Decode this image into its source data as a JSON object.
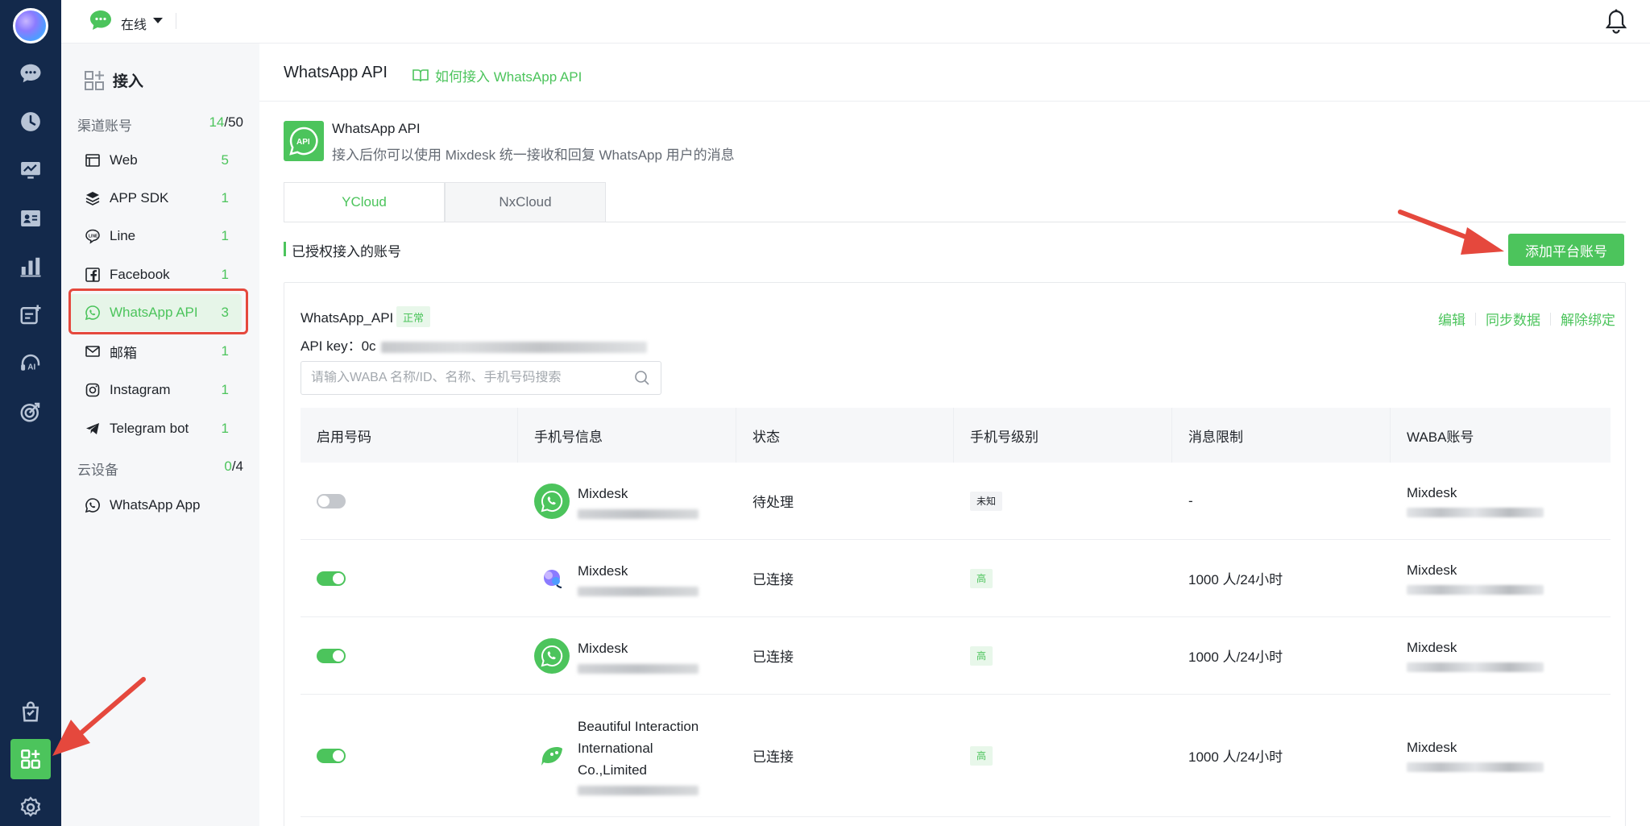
{
  "topbar": {
    "status_label": "在线"
  },
  "rail": {
    "items": [
      {
        "icon": "chat-icon"
      },
      {
        "icon": "history-icon"
      },
      {
        "icon": "monitor-icon"
      },
      {
        "icon": "contacts-icon"
      },
      {
        "icon": "stats-icon"
      },
      {
        "icon": "ticket-icon"
      },
      {
        "icon": "ai-agent-icon"
      },
      {
        "icon": "target-icon"
      },
      {
        "icon": "shopping-bag-icon"
      },
      {
        "icon": "integration-icon"
      },
      {
        "icon": "settings-icon"
      }
    ],
    "active": "integration-icon"
  },
  "subnav": {
    "title": "接入",
    "groups": {
      "channels": {
        "label": "渠道账号",
        "used": "14",
        "total": "/50"
      },
      "cloud": {
        "label": "云设备",
        "used": "0",
        "total": "/4"
      }
    },
    "items": [
      {
        "label": "Web",
        "count": "5",
        "icon": "web-icon"
      },
      {
        "label": "APP SDK",
        "count": "1",
        "icon": "layers-icon"
      },
      {
        "label": "Line",
        "count": "1",
        "icon": "line-icon"
      },
      {
        "label": "Facebook",
        "count": "1",
        "icon": "facebook-icon"
      },
      {
        "label": "WhatsApp API",
        "count": "3",
        "icon": "whatsapp-icon"
      },
      {
        "label": "邮箱",
        "count": "1",
        "icon": "mail-icon"
      },
      {
        "label": "Instagram",
        "count": "1",
        "icon": "instagram-icon"
      },
      {
        "label": "Telegram bot",
        "count": "1",
        "icon": "telegram-icon"
      },
      {
        "label": "WhatsApp App",
        "count": "",
        "icon": "whatsapp-icon"
      }
    ]
  },
  "main": {
    "title": "WhatsApp API",
    "how_link": "如何接入 WhatsApp API",
    "app_name": "WhatsApp API",
    "app_desc": "接入后你可以使用 Mixdesk 统一接收和回复 WhatsApp 用户的消息",
    "tabs": [
      "YCloud",
      "NxCloud"
    ],
    "active_tab": "YCloud",
    "section_title": "已授权接入的账号",
    "add_button": "添加平台账号",
    "account": {
      "name": "WhatsApp_API",
      "status": "正常",
      "api_key_label": "API key：",
      "api_key_prefix": "0c",
      "actions": [
        "编辑",
        "同步数据",
        "解除绑定"
      ]
    },
    "search_placeholder": "请输入WABA 名称/ID、名称、手机号码搜索",
    "columns": [
      "启用号码",
      "手机号信息",
      "状态",
      "手机号级别",
      "消息限制",
      "WABA账号"
    ],
    "rows": [
      {
        "enabled": false,
        "name": "Mixdesk",
        "status": "待处理",
        "level": "未知",
        "limit": "-",
        "waba": "Mixdesk",
        "avatar": "whatsapp-avatar-icon"
      },
      {
        "enabled": true,
        "name": "Mixdesk",
        "status": "已连接",
        "level": "高",
        "limit": "1000 人/24小时",
        "waba": "Mixdesk",
        "avatar": "mixdesk-logo-icon"
      },
      {
        "enabled": true,
        "name": "Mixdesk",
        "status": "已连接",
        "level": "高",
        "limit": "1000 人/24小时",
        "waba": "Mixdesk",
        "avatar": "whatsapp-avatar-icon"
      },
      {
        "enabled": true,
        "name": "Beautiful Interaction International Co.,Limited",
        "status": "已连接",
        "level": "高",
        "limit": "1000 人/24小时",
        "waba": "Mixdesk",
        "avatar": "brand-leaf-icon"
      }
    ]
  },
  "colors": {
    "accent": "#4cc45c",
    "rail_bg": "#13294b",
    "annotation": "#e5483d"
  }
}
